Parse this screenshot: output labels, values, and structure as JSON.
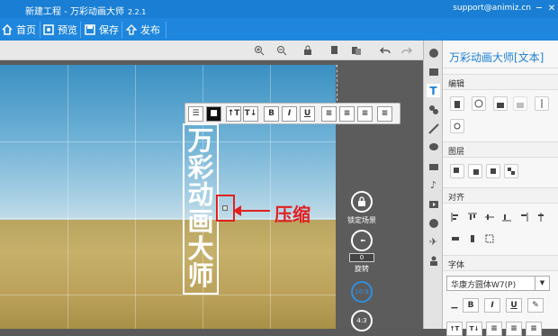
{
  "app": {
    "title": "新建工程 - 万彩动画大师",
    "version": "2.2.1",
    "email": "support@animiz.cn"
  },
  "menu": {
    "home": "首页",
    "preview": "预览",
    "save": "保存",
    "publish": "发布"
  },
  "canvas": {
    "text_content": [
      "万",
      "彩",
      "动",
      "画",
      "大",
      "师"
    ],
    "annotation": "压缩",
    "lock_label": "锁定场景",
    "rotate_label": "旋转",
    "rotate_value": "0",
    "ratio_169": "16:9",
    "ratio_43": "4:3"
  },
  "floatbar": {
    "bold": "B",
    "italic": "I",
    "underline": "U",
    "size_up": "↑T",
    "size_down": "T↓"
  },
  "panel": {
    "title": "万彩动画大师[文本]",
    "edit": "编辑",
    "layer": "图层",
    "align": "对齐",
    "font": "字体",
    "font_name": "华康方圆体W7(P)",
    "bold": "B",
    "italic": "I",
    "underline": "U"
  },
  "colors": {
    "accent": "#1f86dd",
    "annotation": "#e02020"
  }
}
